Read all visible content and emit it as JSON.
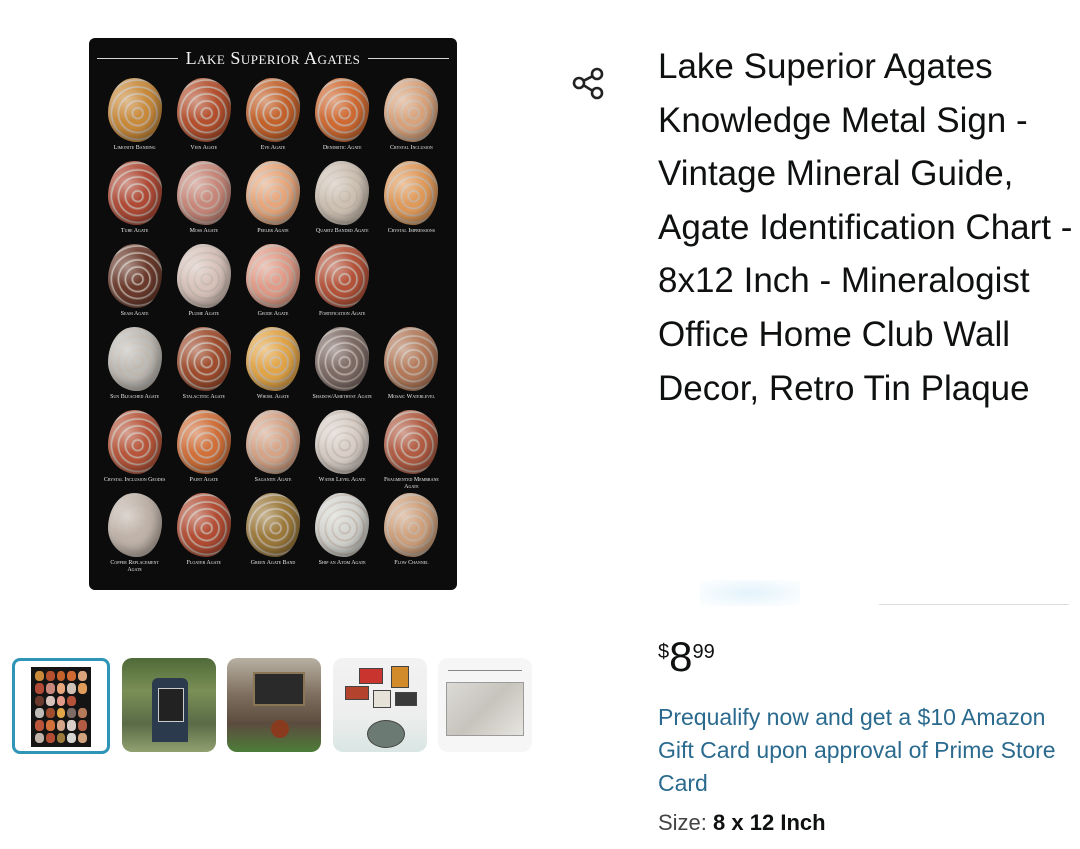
{
  "product": {
    "title": "Lake Superior Agates Knowledge Metal Sign - Vintage Mineral Guide, Agate Identification Chart - 8x12 Inch - Mineralogist Office Home Club Wall Decor, Retro Tin Plaque",
    "share_icon": "share-icon"
  },
  "hero_image": {
    "poster_title": "Lake Superior Agates",
    "agates": [
      {
        "label": "Limonite Banding",
        "color": "#c98a3a"
      },
      {
        "label": "Vein Agate",
        "color": "#b5502e"
      },
      {
        "label": "Eye Agate",
        "color": "#c4622b"
      },
      {
        "label": "Dendritic Agate",
        "color": "#d06a32"
      },
      {
        "label": "Crystal Inclusion",
        "color": "#d9a37c"
      },
      {
        "label": "Tube Agate",
        "color": "#b04a36"
      },
      {
        "label": "Moss Agate",
        "color": "#c8877a"
      },
      {
        "label": "Peeler Agate",
        "color": "#e7a67b"
      },
      {
        "label": "Quartz Banded Agate",
        "color": "#cfc2b4"
      },
      {
        "label": "Crystal Impressions",
        "color": "#e09a5a"
      },
      {
        "label": "Seam Agate",
        "color": "#6b3a2c"
      },
      {
        "label": "Plume Agate",
        "color": "#d8c3bb"
      },
      {
        "label": "Geode Agate",
        "color": "#e19b88"
      },
      {
        "label": "Fortification Agate",
        "color": "#b5533a"
      },
      {
        "label": "",
        "color": "#000000"
      },
      {
        "label": "Sun Bleached Agate",
        "color": "#bfbcb7"
      },
      {
        "label": "Stalactitic Agate",
        "color": "#a04d2e"
      },
      {
        "label": "Whorl Agate",
        "color": "#e2a547"
      },
      {
        "label": "Shadow/Amethyst Agate",
        "color": "#7d6b66"
      },
      {
        "label": "Mosaic Waterlevel",
        "color": "#b47a5a"
      },
      {
        "label": "Crystal Inclusion Geodes",
        "color": "#b8553a"
      },
      {
        "label": "Paint Agate",
        "color": "#d2703a"
      },
      {
        "label": "Saganite Agate",
        "color": "#d6a487"
      },
      {
        "label": "Water Level Agate",
        "color": "#d9cfc8"
      },
      {
        "label": "Fragmented Membrane Agate",
        "color": "#b25c43"
      },
      {
        "label": "Copper Replacement Agate",
        "color": "#c0b3a9"
      },
      {
        "label": "Floater Agate",
        "color": "#b34d34"
      },
      {
        "label": "Green Agate Band",
        "color": "#9c7a3b"
      },
      {
        "label": "Ship an Atom Agate",
        "color": "#d4d4d0"
      },
      {
        "label": "Flow Channel",
        "color": "#cfa17d"
      }
    ]
  },
  "price": {
    "symbol": "$",
    "whole": "8",
    "fraction": "99"
  },
  "promo": {
    "text": "Prequalify now and get a $10 Amazon Gift Card upon approval of Prime Store Card"
  },
  "size": {
    "label": "Size:",
    "value": "8 x 12 Inch"
  },
  "thumbnails": [
    {
      "name": "thumb-agate-chart",
      "selected": true
    },
    {
      "name": "thumb-door-scene",
      "selected": false
    },
    {
      "name": "thumb-barn-scene",
      "selected": false
    },
    {
      "name": "thumb-wall-signs",
      "selected": false
    },
    {
      "name": "thumb-dimensions",
      "selected": false
    }
  ],
  "colors": {
    "link": "#2a6a8e",
    "thumb_selected_border": "#2f95b6",
    "text": "#0f1111"
  }
}
